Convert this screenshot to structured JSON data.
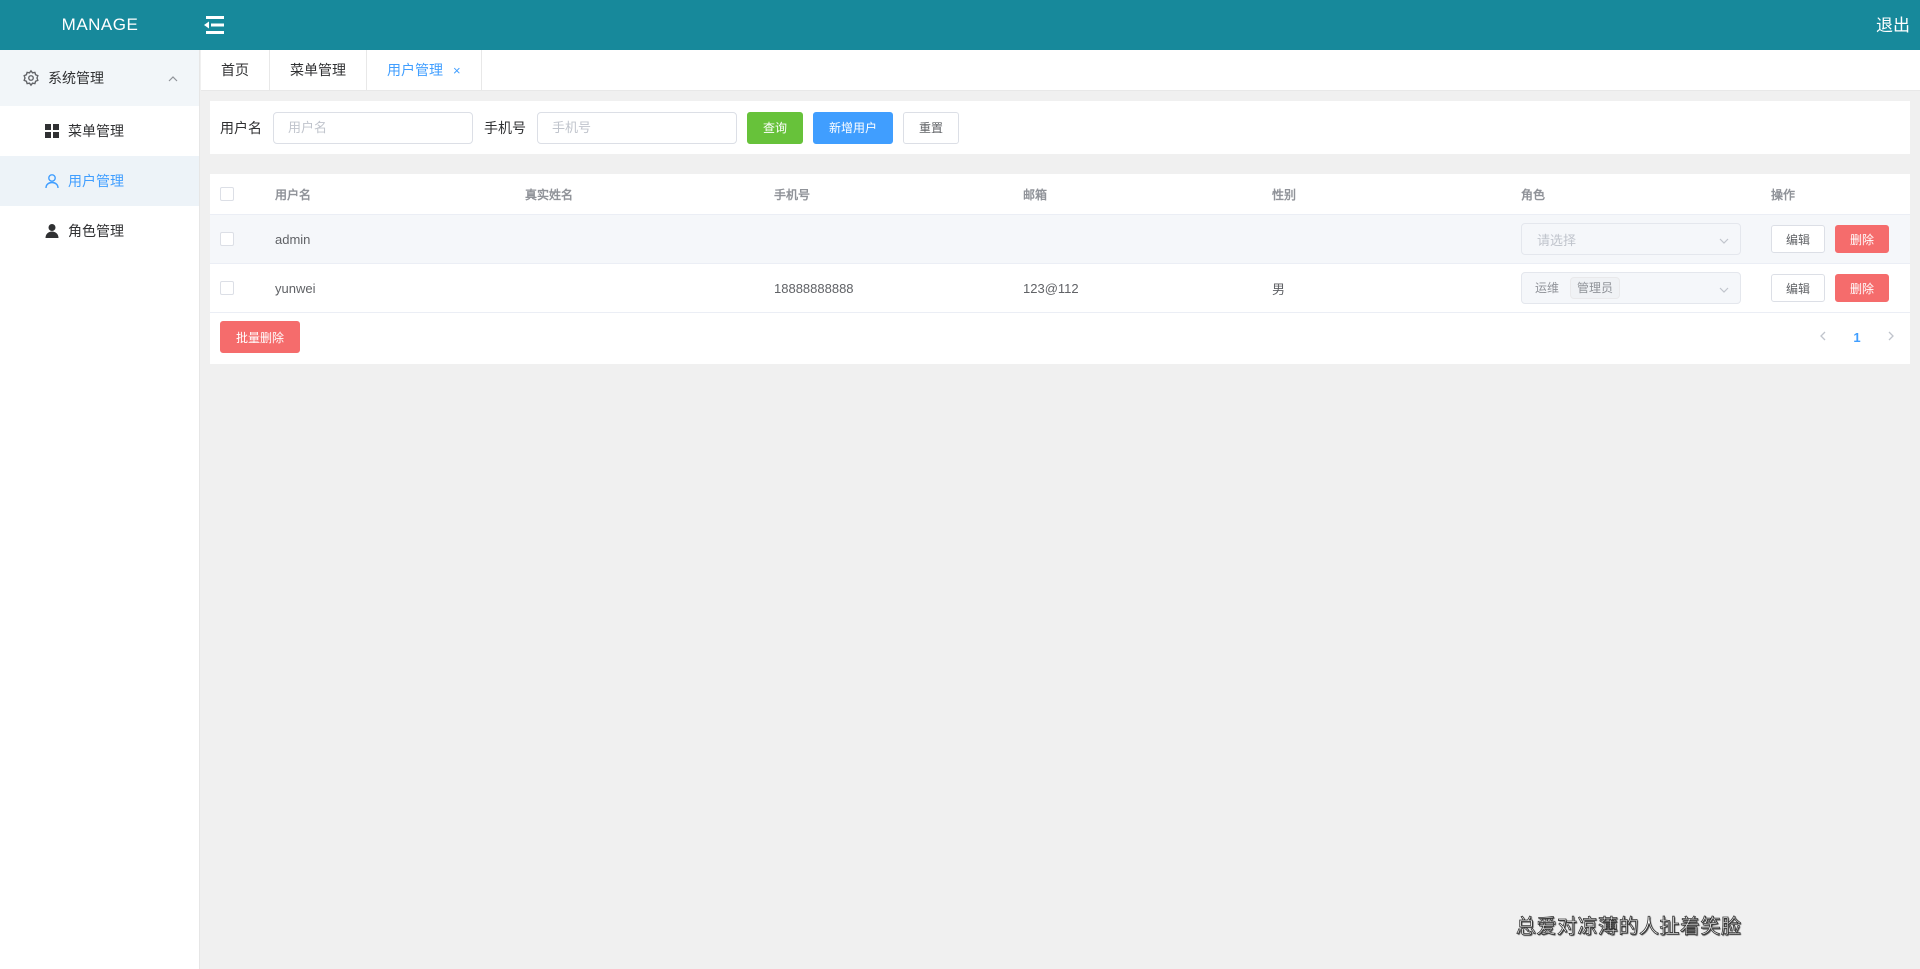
{
  "header": {
    "logo": "MANAGE",
    "logout": "退出",
    "collapse_icon": "menu-fold-icon",
    "bg_color": "#17899b"
  },
  "sidebar": {
    "group": {
      "label": "系统管理",
      "icon": "gear-icon",
      "expanded": true
    },
    "items": [
      {
        "label": "菜单管理",
        "icon": "grid-icon",
        "active": false
      },
      {
        "label": "用户管理",
        "icon": "user-outline-icon",
        "active": true
      },
      {
        "label": "角色管理",
        "icon": "user-solid-icon",
        "active": false
      }
    ]
  },
  "tabs": [
    {
      "label": "首页",
      "active": false
    },
    {
      "label": "菜单管理",
      "active": false
    },
    {
      "label": "用户管理",
      "active": true,
      "closable": true,
      "close": "×"
    }
  ],
  "search": {
    "username_label": "用户名",
    "username_placeholder": "用户名",
    "username_value": "",
    "phone_label": "手机号",
    "phone_placeholder": "手机号",
    "phone_value": "",
    "query_button": "查询",
    "add_button": "新增用户",
    "reset_button": "重置"
  },
  "table": {
    "columns": [
      "用户名",
      "真实姓名",
      "手机号",
      "邮箱",
      "性别",
      "角色",
      "操作"
    ],
    "rows": [
      {
        "username": "admin",
        "real_name": "",
        "phone": "",
        "email": "",
        "gender": "",
        "roles": [],
        "role_placeholder": "请选择"
      },
      {
        "username": "yunwei",
        "real_name": "",
        "phone": "18888888888",
        "email": "123@112",
        "gender": "男",
        "roles": [
          "运维",
          "管理员"
        ],
        "role_placeholder": ""
      }
    ],
    "edit_label": "编辑",
    "delete_label": "删除"
  },
  "batch_delete_button": "批量删除",
  "pagination": {
    "current_page": "1",
    "prev_icon": "chevron-left-icon",
    "next_icon": "chevron-right-icon"
  },
  "watermark": "总爱对凉薄的人扯着笑脸"
}
